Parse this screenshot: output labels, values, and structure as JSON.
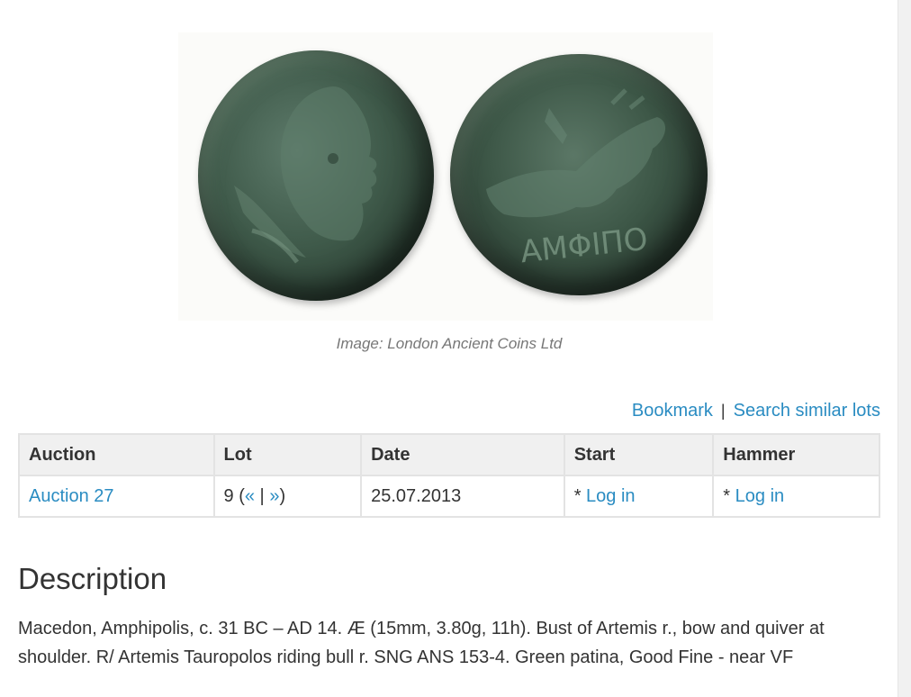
{
  "image": {
    "obverse_alt": "Obverse: Bust of Artemis right, bow and quiver at shoulder",
    "reverse_alt": "Reverse: Artemis Tauropolos riding bull right",
    "reverse_legend": "ΑΜΦΙΠΟ",
    "caption": "Image: London Ancient Coins Ltd"
  },
  "actions": {
    "bookmark": "Bookmark",
    "separator": "|",
    "search_similar": "Search similar lots"
  },
  "table": {
    "headers": {
      "auction": "Auction",
      "lot": "Lot",
      "date": "Date",
      "start": "Start",
      "hammer": "Hammer"
    },
    "row": {
      "auction": "Auction 27",
      "lot_number": "9 (",
      "prev": "«",
      "nav_sep": " | ",
      "next": "»",
      "lot_close": ")",
      "date": "25.07.2013",
      "start_prefix": "* ",
      "start_link": "Log in",
      "hammer_prefix": "* ",
      "hammer_link": "Log in"
    }
  },
  "description": {
    "title": "Description",
    "text": "Macedon, Amphipolis, c. 31 BC – AD 14. Æ (15mm, 3.80g, 11h). Bust of Artemis r., bow and quiver at shoulder. R/ Artemis Tauropolos riding bull r. SNG ANS 153-4. Green patina, Good Fine - near VF"
  },
  "colors": {
    "link": "#2a8cc2",
    "text": "#333333",
    "header_bg": "#f0f0f0",
    "border": "#e3e3e3",
    "caption": "#777777"
  }
}
